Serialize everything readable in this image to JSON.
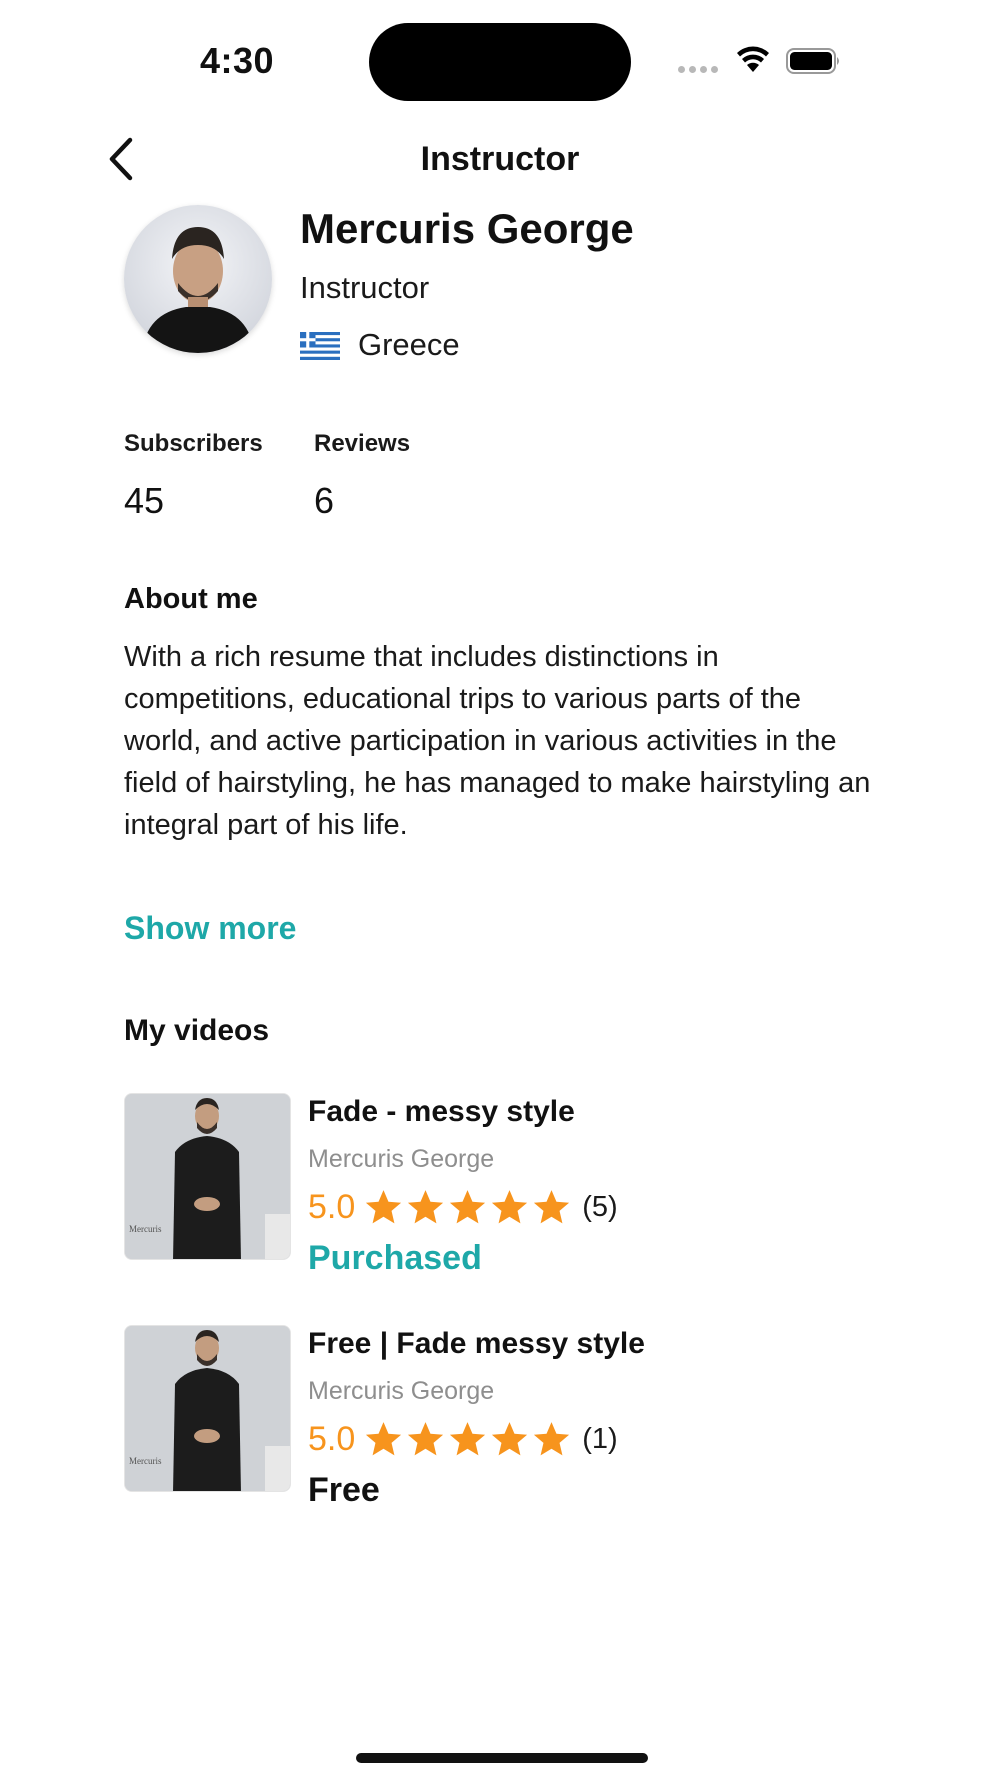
{
  "status_bar": {
    "time": "4:30"
  },
  "nav": {
    "title": "Instructor",
    "back_icon": "chevron-left-icon"
  },
  "profile": {
    "name": "Mercuris George",
    "role": "Instructor",
    "country": "Greece",
    "flag_icon": "greece-flag-icon"
  },
  "stats": [
    {
      "label": "Subscribers",
      "value": "45"
    },
    {
      "label": "Reviews",
      "value": "6"
    }
  ],
  "about": {
    "title": "About me",
    "text": "With a rich resume that includes distinctions in competitions, educational trips to various parts of the world, and active participation in various activities in the field of hairstyling, he has managed to make hairstyling an integral part of his life.",
    "show_more_label": "Show more"
  },
  "videos": {
    "title": "My videos",
    "items": [
      {
        "title": "Fade - messy style",
        "author": "Mercuris George",
        "rating": "5.0",
        "stars": 5,
        "count": "(5)",
        "status": "Purchased"
      },
      {
        "title": "Free | Fade messy style",
        "author": "Mercuris George",
        "rating": "5.0",
        "stars": 5,
        "count": "(1)",
        "status": "Free"
      }
    ]
  },
  "colors": {
    "accent": "#1ea8a8",
    "star": "#f7941d",
    "muted": "#8e8e8e"
  }
}
